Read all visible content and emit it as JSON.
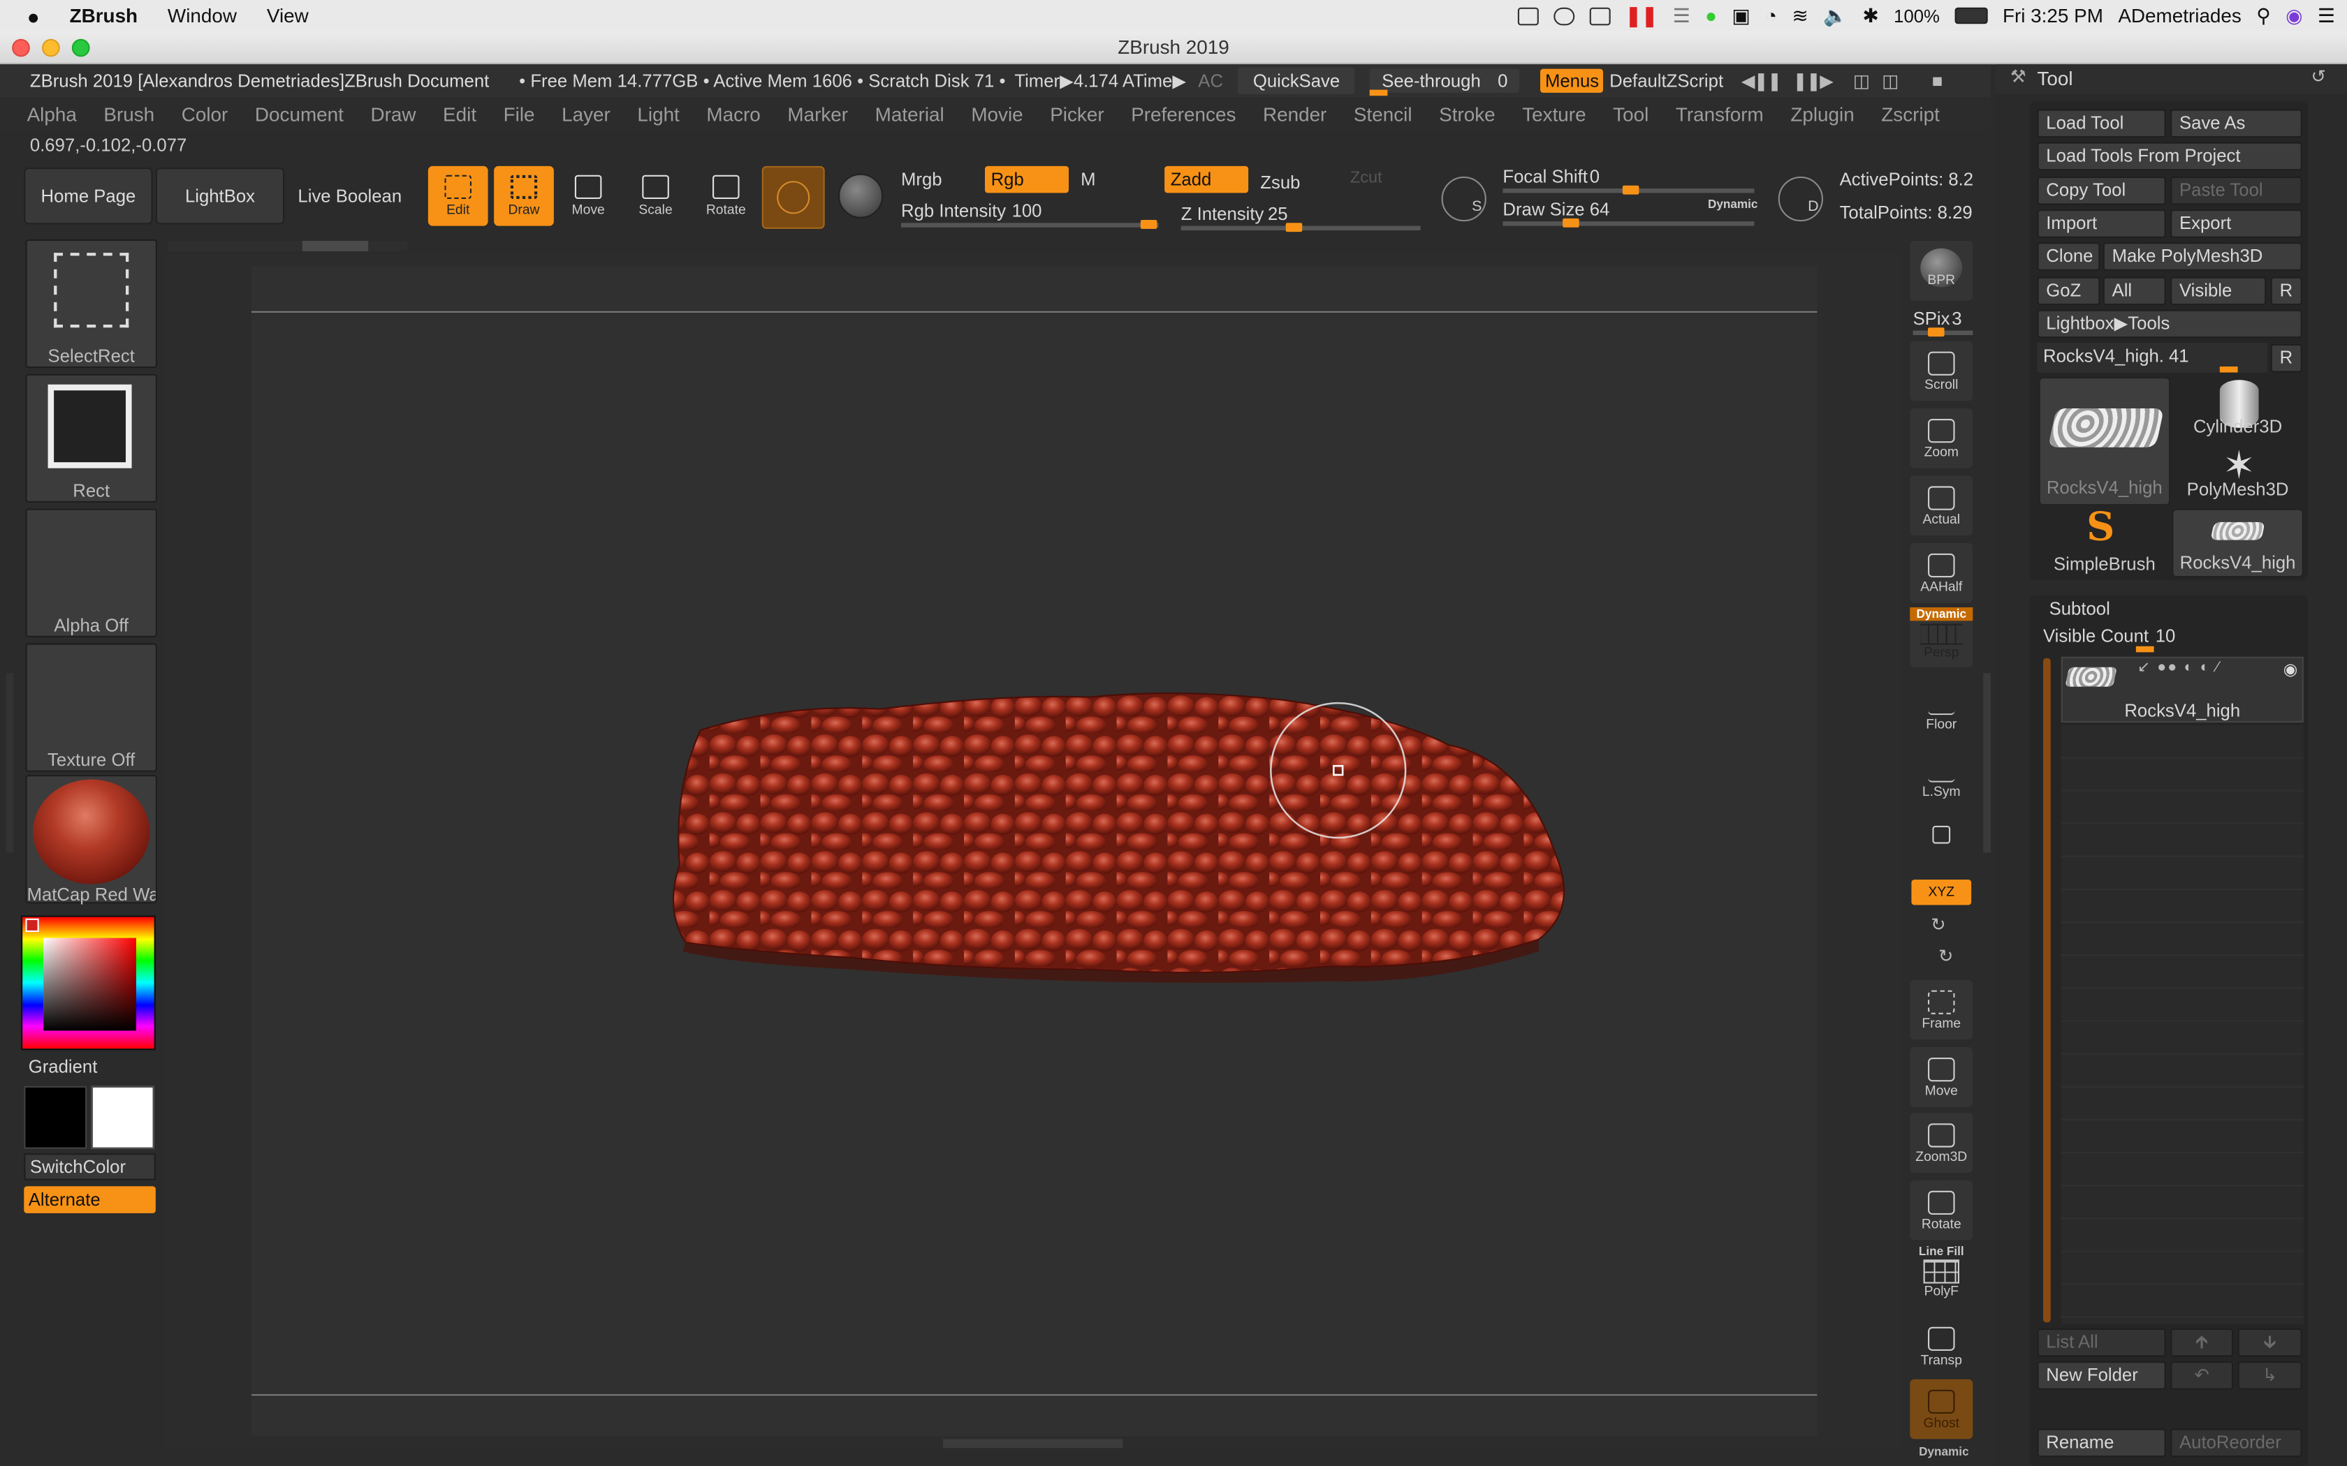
{
  "macos": {
    "menus": [
      "ZBrush",
      "Window",
      "View"
    ],
    "battery": "100%",
    "clock": "Fri 3:25 PM",
    "user": "ADemetriades"
  },
  "window": {
    "title": "ZBrush 2019"
  },
  "infobar": {
    "doc_title": "ZBrush 2019 [Alexandros Demetriades]ZBrush Document",
    "mem_stats": "• Free Mem 14.777GB • Active Mem 1606 • Scratch Disk 71 •",
    "timer": "Timer▶4.174 ATime▶",
    "ac": "AC",
    "quicksave": "QuickSave",
    "see_through": "See-through",
    "see_through_value": "0",
    "menus_toggle": "Menus",
    "default_zscript": "DefaultZScript"
  },
  "zmenu": [
    "Alpha",
    "Brush",
    "Color",
    "Document",
    "Draw",
    "Edit",
    "File",
    "Layer",
    "Light",
    "Macro",
    "Marker",
    "Material",
    "Movie",
    "Picker",
    "Preferences",
    "Render",
    "Stencil",
    "Stroke",
    "Texture",
    "Tool",
    "Transform",
    "Zplugin",
    "Zscript"
  ],
  "coords": "0.697,-0.102,-0.077",
  "toolbar": {
    "home_page": "Home Page",
    "lightbox": "LightBox",
    "live_boolean": "Live Boolean",
    "edit": "Edit",
    "draw": "Draw",
    "move": "Move",
    "scale": "Scale",
    "rotate": "Rotate",
    "mrgb": "Mrgb",
    "rgb": "Rgb",
    "m": "M",
    "zadd": "Zadd",
    "zsub": "Zsub",
    "zcut": "Zcut",
    "rgb_intensity_label": "Rgb Intensity",
    "rgb_intensity": "100",
    "rgb_intensity_level": 1.0,
    "z_intensity_label": "Z Intensity",
    "z_intensity": "25",
    "z_intensity_level": 0.25,
    "focal_shift_label": "Focal Shift",
    "focal_shift": "0",
    "draw_size_label": "Draw Size",
    "draw_size": "64",
    "dynamic": "Dynamic",
    "active_points": "ActivePoints: 8.2",
    "total_points": "TotalPoints: 8.29"
  },
  "left_shelf": {
    "brush": "SelectRect",
    "stroke": "Rect",
    "alpha": "Alpha Off",
    "texture": "Texture Off",
    "material": "MatCap Red Wa",
    "gradient": "Gradient",
    "switch_color": "SwitchColor",
    "alternate": "Alternate"
  },
  "right_shelf": {
    "bpr": "BPR",
    "spix_label": "SPix",
    "spix_value": "3",
    "scroll": "Scroll",
    "zoom": "Zoom",
    "actual": "Actual",
    "aahalf": "AAHalf",
    "dynamic": "Dynamic",
    "persp": "Persp",
    "floor": "Floor",
    "lsym": "L.Sym",
    "xyz": "XYZ",
    "frame": "Frame",
    "move": "Move",
    "zoom3d": "Zoom3D",
    "rotate": "Rotate",
    "line_fill": "Line Fill",
    "polyf": "PolyF",
    "transp": "Transp",
    "ghost": "Ghost",
    "dynamic2": "Dynamic"
  },
  "tool_panel": {
    "title": "Tool",
    "load_tool": "Load Tool",
    "save_as": "Save As",
    "load_from_project": "Load Tools From Project",
    "copy_tool": "Copy Tool",
    "paste_tool": "Paste Tool",
    "import": "Import",
    "export": "Export",
    "clone": "Clone",
    "make_polymesh": "Make PolyMesh3D",
    "goz": "GoZ",
    "all": "All",
    "visible": "Visible",
    "r": "R",
    "lightbox_tools": "Lightbox▶Tools",
    "tool_slider_label": "RocksV4_high.",
    "tool_slider_value": "41",
    "thumbs": [
      "RocksV4_high",
      "Cylinder3D",
      "PolyMesh3D",
      "SimpleBrush",
      "RocksV4_high"
    ]
  },
  "subtool": {
    "title": "Subtool",
    "visible_count_label": "Visible Count",
    "visible_count": "10",
    "item": "RocksV4_high",
    "list_all": "List All",
    "new_folder": "New Folder",
    "rename": "Rename",
    "auto_reorder": "AutoReorder"
  },
  "colors": {
    "accent": "#f79216",
    "rock": "#9c2a1d",
    "bg": "#2b2b2b",
    "canvas": "#303030"
  }
}
